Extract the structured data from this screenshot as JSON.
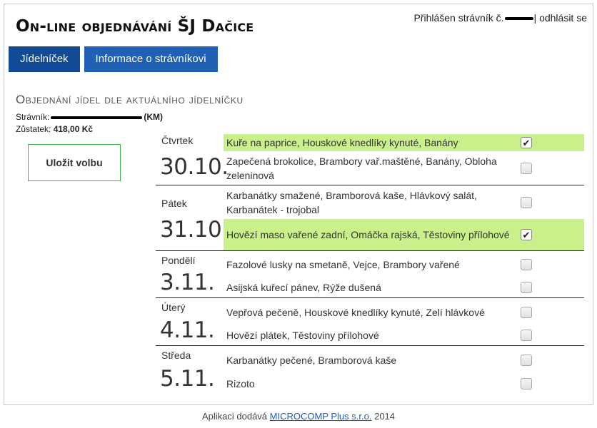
{
  "header": {
    "title": "On-line objednávání ŠJ Dačice",
    "login_prefix": "Přihlášen strávník č.",
    "login_separator": "|",
    "logout_label": "odhlásit se"
  },
  "nav": {
    "menu_label": "Jídelníček",
    "info_label": "Informace o strávníkovi"
  },
  "order": {
    "heading": "Objednání jídel dle aktuálního jídelníčku",
    "diner_label": "Strávník:",
    "diner_suffix": "(KM)",
    "balance_label": "Zůstatek:",
    "balance_value": "418,00 Kč",
    "save_label": "Uložit volbu"
  },
  "days": [
    {
      "name": "Čtvrtek",
      "date": "30.10.",
      "meals": [
        {
          "text": "Kuře na paprice, Houskové knedlíky kynuté, Banány",
          "checked": true
        },
        {
          "text": "Zapečená brokolice, Brambory vař.maštěné, Banány, Obloha zeleninová",
          "checked": false
        }
      ]
    },
    {
      "name": "Pátek",
      "date": "31.10.",
      "meals": [
        {
          "text": "Karbanátky smažené, Bramborová kaše, Hlávkový salát, Karbanátek - trojobal",
          "checked": false
        },
        {
          "text": "Hovězí maso vařené zadní, Omáčka rajská, Těstoviny přílohové",
          "checked": true
        }
      ]
    },
    {
      "name": "Pondělí",
      "date": "3.11.",
      "meals": [
        {
          "text": "Fazolové lusky na smetaně, Vejce, Brambory vařené",
          "checked": false
        },
        {
          "text": "Asijská kuřecí pánev, Rýže dušená",
          "checked": false
        }
      ]
    },
    {
      "name": "Úterý",
      "date": "4.11.",
      "meals": [
        {
          "text": "Vepřová pečeně, Houskové knedlíky kynuté, Zelí hlávkové",
          "checked": false
        },
        {
          "text": "Hovězí plátek, Těstoviny přílohové",
          "checked": false
        }
      ]
    },
    {
      "name": "Středa",
      "date": "5.11.",
      "meals": [
        {
          "text": "Karbanátky pečené, Bramborová kaše",
          "checked": false
        },
        {
          "text": "Rizoto",
          "checked": false
        }
      ]
    }
  ],
  "footer": {
    "prefix": "Aplikaci dodává",
    "link": "MICROCOMP Plus s.r.o.",
    "year": "2014"
  },
  "colors": {
    "nav_blue": "#1f5fb4",
    "chosen_highlight": "#c9f08b",
    "save_border": "#3cb54a"
  }
}
